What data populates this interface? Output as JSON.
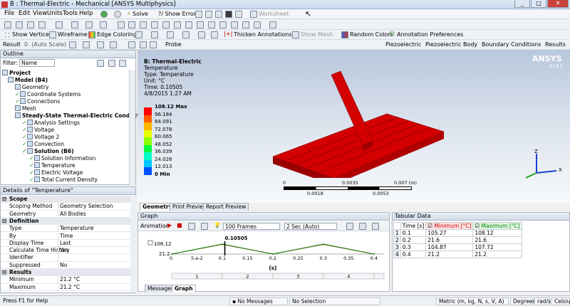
{
  "window": {
    "title": "B : Thermal-Electric - Mechanical [ANSYS Multiphysics]",
    "minimize": "_",
    "maximize": "□",
    "close": "✕"
  },
  "menu": [
    "File",
    "Edit",
    "View",
    "Units",
    "Tools",
    "Help"
  ],
  "toolbar1": {
    "solve": "Solve",
    "show_errors": "?/ Show Errors",
    "worksheet": "Worksheet"
  },
  "toolbar3": {
    "show_vertices": "Show Vertices",
    "wireframe": "Wireframe",
    "edge_coloring": "Edge Coloring",
    "thicken_annotations": "Thicken Annotations",
    "show_mesh": "Show Mesh",
    "random_colors": "Random Colors",
    "annotation_prefs": "Annotation Preferences"
  },
  "toolbar4": {
    "result_label": "Result",
    "result_scale": "0. (Auto Scale)",
    "probe": "Probe",
    "piezoelectric": "Piezoelectric",
    "piezoelectric_body": "Piezoelectric Body",
    "boundary_conditions": "Boundary Conditions",
    "results": "Results"
  },
  "outline": {
    "title": "Outline",
    "filter_label": "Filter:",
    "filter_value": "Name",
    "nodes": [
      {
        "label": "Project",
        "bold": true,
        "check": false
      },
      {
        "label": "Model (B4)",
        "bold": true,
        "check": false
      },
      {
        "label": "Geometry",
        "bold": false,
        "check": false
      },
      {
        "label": "Coordinate Systems",
        "bold": false,
        "check": true
      },
      {
        "label": "Connections",
        "bold": false,
        "check": true
      },
      {
        "label": "Mesh",
        "bold": false,
        "check": false
      },
      {
        "label": "Steady-State Thermal-Electric Conduct",
        "bold": true,
        "check": false
      },
      {
        "label": "Analysis Settings",
        "bold": false,
        "check": true
      },
      {
        "label": "Voltage",
        "bold": false,
        "check": true
      },
      {
        "label": "Voltage 2",
        "bold": false,
        "check": true
      },
      {
        "label": "Convection",
        "bold": false,
        "check": true
      },
      {
        "label": "Solution (B6)",
        "bold": true,
        "check": true
      },
      {
        "label": "Solution Information",
        "bold": false,
        "check": true
      },
      {
        "label": "Temperature",
        "bold": false,
        "check": true
      },
      {
        "label": "Electric Voltage",
        "bold": false,
        "check": true
      },
      {
        "label": "Total Current Density",
        "bold": false,
        "check": true
      }
    ]
  },
  "details": {
    "title": "Details of \"Temperature\"",
    "rows": [
      {
        "k": "Scope",
        "v": "",
        "sec": true
      },
      {
        "k": "Scoping Method",
        "v": "Geometry Selection",
        "sec": false
      },
      {
        "k": "Geometry",
        "v": "All Bodies",
        "sec": false
      },
      {
        "k": "Definition",
        "v": "",
        "sec": true
      },
      {
        "k": "Type",
        "v": "Temperature",
        "sec": false
      },
      {
        "k": "By",
        "v": "Time",
        "sec": false
      },
      {
        "k": "Display Time",
        "v": "Last",
        "sec": false
      },
      {
        "k": "Calculate Time History",
        "v": "Yes",
        "sec": false
      },
      {
        "k": "Identifier",
        "v": "",
        "sec": false
      },
      {
        "k": "Suppressed",
        "v": "No",
        "sec": false
      },
      {
        "k": "Results",
        "v": "",
        "sec": true
      },
      {
        "k": "Minimum",
        "v": "21.2 °C",
        "sec": false
      },
      {
        "k": "Maximum",
        "v": "21.2 °C",
        "sec": false
      }
    ]
  },
  "viewport": {
    "heading": "B: Thermal-Electric",
    "info": [
      "Temperature",
      "Type: Temperature",
      "Unit: °C",
      "Time: 0.10505",
      "4/8/2015 1:27 AM"
    ],
    "brand": "ANSYS",
    "version": "R14.5",
    "legend_values": [
      "108.12 Max",
      "96.184",
      "84.091",
      "72.078",
      "60.065",
      "48.052",
      "36.039",
      "24.026",
      "12.013",
      "0 Min"
    ],
    "legend_colors": [
      "#ff0000",
      "#ff5a00",
      "#ffb400",
      "#e8ff00",
      "#8cff00",
      "#00ff3c",
      "#00ffc8",
      "#00c8ff",
      "#0050ff",
      "#0000ff"
    ],
    "scale": {
      "ticks_top": [
        "0",
        "0.0035",
        "0.007 (m)"
      ],
      "ticks_bottom": [
        "0.0018",
        "0.0053"
      ]
    }
  },
  "viewtabs": [
    "Geometry",
    "Print Preview",
    "Report Preview"
  ],
  "graph": {
    "title": "Graph",
    "animation": "Animation",
    "frames": "100 Frames",
    "speed": "2 Sec (Auto)",
    "ymax": "108.12",
    "ymin": "21.2",
    "marker": "0.10505",
    "xticks": [
      "0.",
      "5.e-2",
      "0.1",
      "0.15",
      "0.2",
      "0.25",
      "0.3",
      "0.35",
      "0.4"
    ],
    "xunit": "[s]",
    "steps": [
      "1",
      "2",
      "3",
      "4"
    ]
  },
  "bottomtabs": [
    "Messages",
    "Graph"
  ],
  "tabular": {
    "title": "Tabular Data",
    "headers": [
      "Time [s]",
      "Minimum [°C]",
      "Maximum [°C]"
    ],
    "rows": [
      {
        "n": "1",
        "time": "0.1",
        "min": "105.27",
        "max": "108.12"
      },
      {
        "n": "2",
        "time": "0.2",
        "min": "21.6",
        "max": "21.6"
      },
      {
        "n": "3",
        "time": "0.3",
        "min": "104.87",
        "max": "107.72"
      },
      {
        "n": "4",
        "time": "0.4",
        "min": "21.2",
        "max": "21.2"
      }
    ]
  },
  "status": {
    "help": "Press F1 for Help",
    "messages": "No Messages",
    "selection": "No Selection",
    "units": "Metric (m, kg, N, s, V, A)",
    "angle": "Degrees",
    "rate": "rad/s",
    "temp": "Celsius"
  },
  "chart_data": {
    "type": "line",
    "x": [
      0.0,
      0.1,
      0.2,
      0.3,
      0.4
    ],
    "series": [
      {
        "name": "Minimum [°C]",
        "values": [
          21.2,
          105.27,
          21.6,
          104.87,
          21.2
        ]
      },
      {
        "name": "Maximum [°C]",
        "values": [
          21.2,
          108.12,
          21.6,
          107.72,
          21.2
        ]
      }
    ],
    "xlabel": "[s]",
    "ylim": [
      21.2,
      108.12
    ],
    "xlim": [
      0,
      0.42
    ]
  }
}
